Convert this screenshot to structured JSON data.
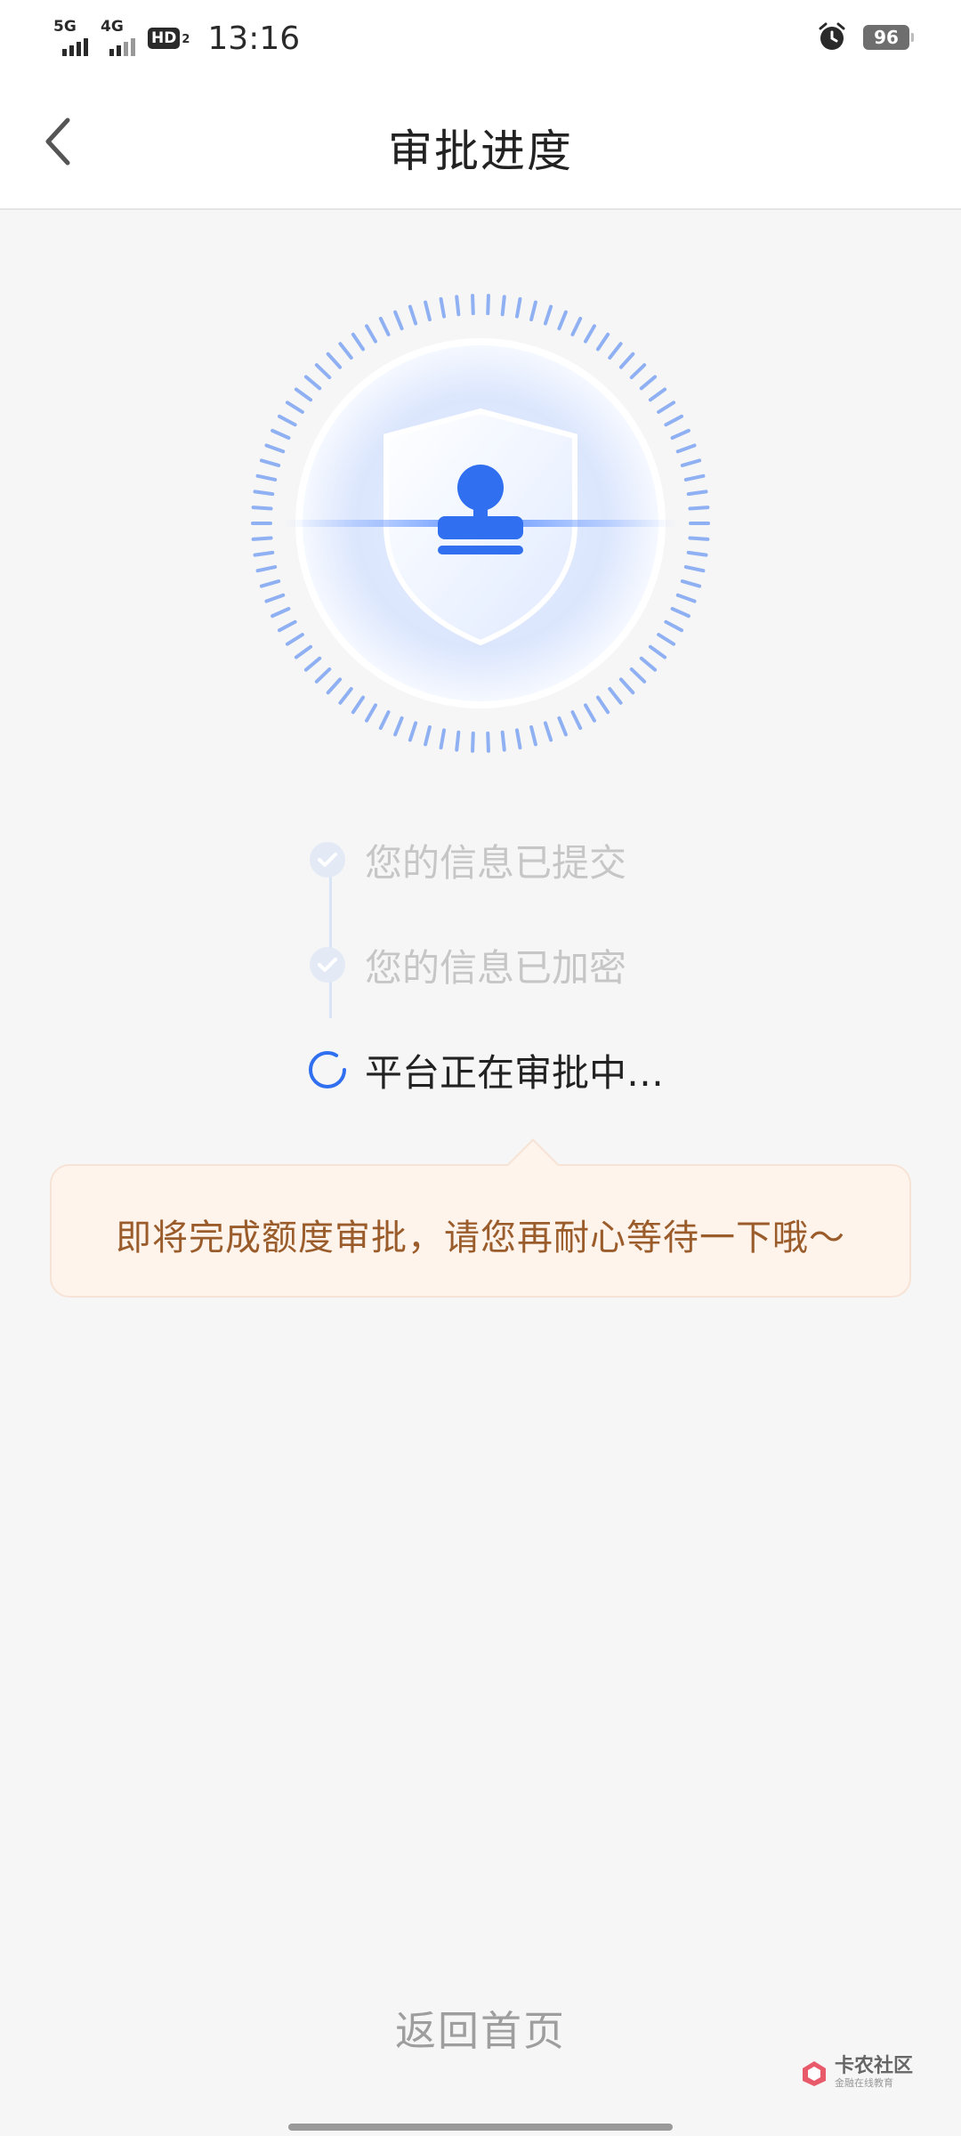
{
  "status_bar": {
    "network1": "5G",
    "network2": "4G",
    "hd": "HD",
    "hd_sub": "2",
    "time": "13:16",
    "battery": "96"
  },
  "nav": {
    "title": "审批进度"
  },
  "steps": [
    {
      "label": "您的信息已提交",
      "state": "done"
    },
    {
      "label": "您的信息已加密",
      "state": "done"
    },
    {
      "label": "平台正在审批中…",
      "state": "active"
    }
  ],
  "tip": {
    "text": "即将完成额度审批，请您再耐心等待一下哦～"
  },
  "footer": {
    "home_link": "返回首页"
  },
  "watermark": {
    "main": "卡农社区",
    "sub": "金融在线教育"
  },
  "colors": {
    "accent": "#2f6ff0",
    "tip_text": "#9b5c2b",
    "tip_bg": "#fff4ec"
  }
}
